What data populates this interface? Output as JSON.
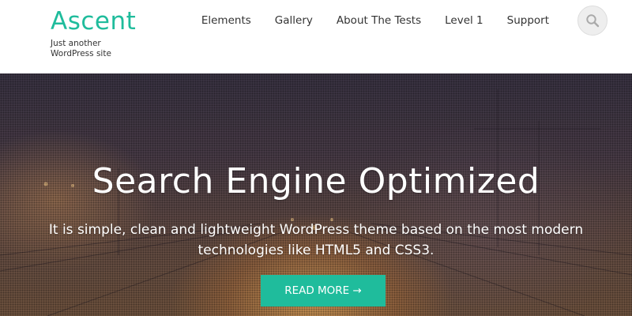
{
  "site": {
    "title": "Ascent",
    "tagline": "Just another WordPress site"
  },
  "nav": {
    "items": [
      {
        "label": "Elements"
      },
      {
        "label": "Gallery"
      },
      {
        "label": "About The Tests"
      },
      {
        "label": "Level 1"
      },
      {
        "label": "Support"
      }
    ],
    "search_icon": "search-icon"
  },
  "hero": {
    "title": "Search Engine Optimized",
    "text": "It is simple, clean and lightweight WordPress theme based on the most modern technologies like HTML5 and CSS3.",
    "button_label": "READ MORE →"
  },
  "colors": {
    "accent": "#1fbc9c",
    "text": "#333333",
    "hero_text": "#ffffff"
  }
}
